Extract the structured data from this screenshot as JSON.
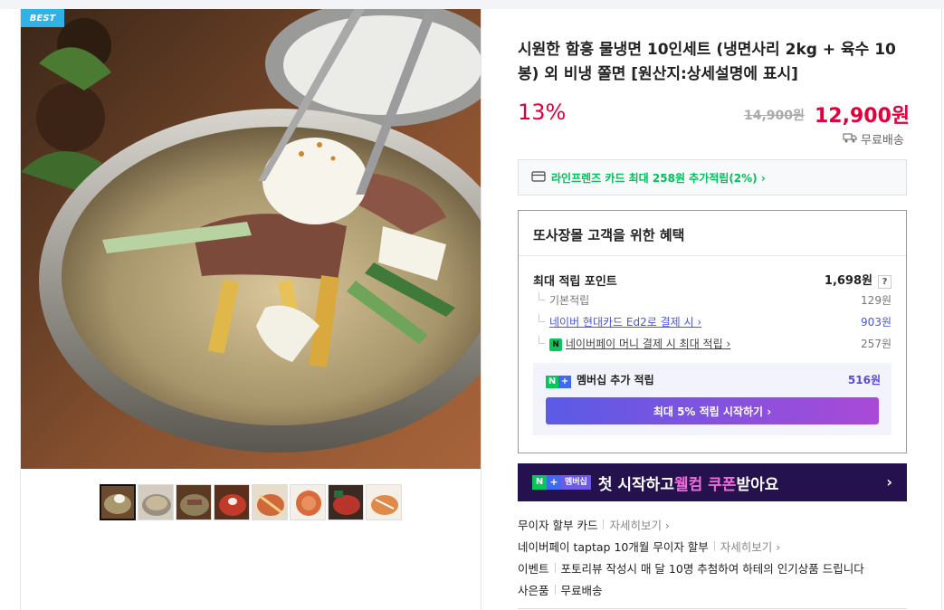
{
  "badge": {
    "best": "BEST"
  },
  "product": {
    "title": "시원한 함흥 물냉면 10인세트 (냉면사리 2kg + 육수 10봉) 외 비냉 쫄면 [원산지:상세설명에 표시]",
    "discount": "13%",
    "original_price": "14,900원",
    "sale_price": "12,900원",
    "shipping": "무료배송"
  },
  "card_banner": {
    "text": "라인프렌즈 카드 최대 258원 추가적립(2%) ›"
  },
  "benefits": {
    "title": "또사장몰 고객을 위한 혜택",
    "max_points_label": "최대 적립 포인트",
    "max_points_value": "1,698원",
    "help": "?",
    "items": [
      {
        "label": "기본적립",
        "value": "129원"
      },
      {
        "label": "네이버 현대카드 Ed2로 결제 시 ›",
        "value": "903원"
      },
      {
        "label": "네이버페이 머니 결제 시 최대 적립 ›",
        "value": "257원"
      }
    ],
    "member_label": "멤버십 추가 적립",
    "member_value": "516원",
    "start_button": "최대 5% 적립 시작하기 ›"
  },
  "promo": {
    "badge_n": "N",
    "badge_plus": "+",
    "badge_text": "멤버십",
    "text_pre": "첫 시작하고 ",
    "text_highlight": "웰컴 쿠폰",
    "text_post": " 받아요",
    "arrow": "›"
  },
  "info": [
    {
      "label": "무이자 할부 카드",
      "more": "자세히보기 ›"
    },
    {
      "label": "네이버페이 taptap 10개월 무이자 할부",
      "more": "자세히보기 ›"
    },
    {
      "label": "이벤트",
      "detail": "포토리뷰 작성시 매 달 10명 추첨하여 하테의 인기상품 드립니다"
    },
    {
      "label": "사은품",
      "detail": "무료배송"
    }
  ],
  "icons": {
    "shipping": "truck-icon",
    "card": "credit-card-icon",
    "npay": "naverpay-icon"
  },
  "colors": {
    "accent_red": "#e0003c",
    "accent_green": "#00c25a",
    "member_purple": "#5a4ad8",
    "promo_bg": "#24124f"
  }
}
